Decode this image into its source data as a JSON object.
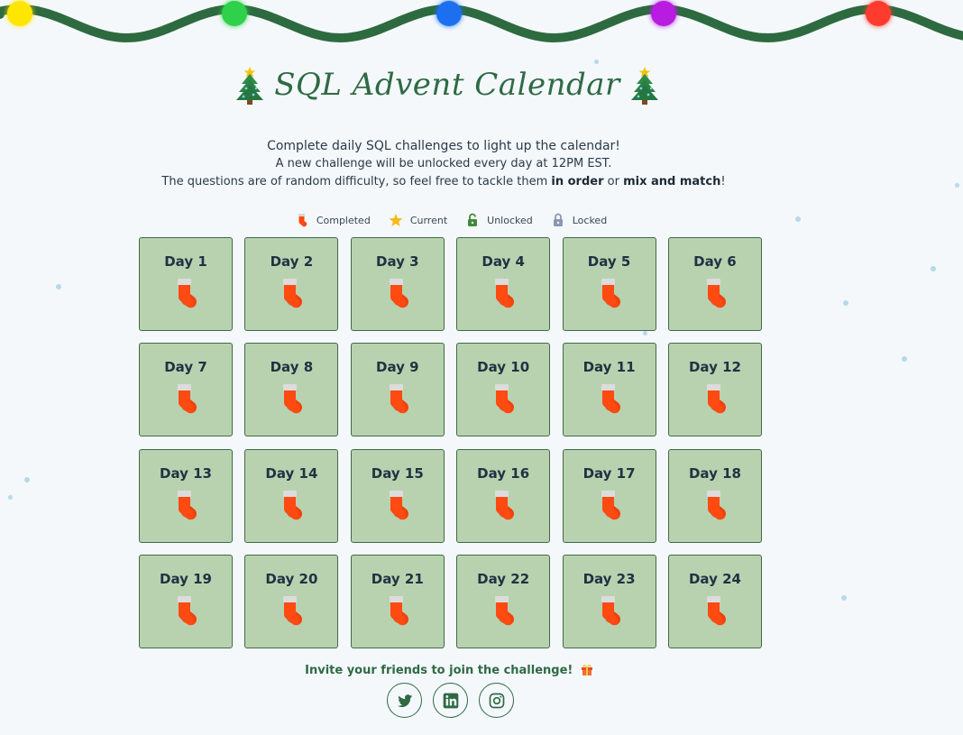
{
  "header": {
    "title": "SQL Advent Calendar",
    "left_icon": "christmas-tree-icon",
    "right_icon": "christmas-tree-icon"
  },
  "intro": {
    "line1": "Complete daily SQL challenges to light up the calendar!",
    "line2": "A new challenge will be unlocked every day at 12PM EST.",
    "line3_prefix": "The questions are of random difficulty, so feel free to tackle them ",
    "line3_bold1": "in order",
    "line3_mid": " or ",
    "line3_bold2": "mix and match",
    "line3_suffix": "!"
  },
  "legend": [
    {
      "label": "Completed",
      "icon": "stocking-icon"
    },
    {
      "label": "Current",
      "icon": "star-icon"
    },
    {
      "label": "Unlocked",
      "icon": "unlocked-padlock-icon"
    },
    {
      "label": "Locked",
      "icon": "locked-padlock-icon"
    }
  ],
  "days": [
    {
      "label": "Day 1",
      "status": "completed"
    },
    {
      "label": "Day 2",
      "status": "completed"
    },
    {
      "label": "Day 3",
      "status": "completed"
    },
    {
      "label": "Day 4",
      "status": "completed"
    },
    {
      "label": "Day 5",
      "status": "completed"
    },
    {
      "label": "Day 6",
      "status": "completed"
    },
    {
      "label": "Day 7",
      "status": "completed"
    },
    {
      "label": "Day 8",
      "status": "completed"
    },
    {
      "label": "Day 9",
      "status": "completed"
    },
    {
      "label": "Day 10",
      "status": "completed"
    },
    {
      "label": "Day 11",
      "status": "completed"
    },
    {
      "label": "Day 12",
      "status": "completed"
    },
    {
      "label": "Day 13",
      "status": "completed"
    },
    {
      "label": "Day 14",
      "status": "completed"
    },
    {
      "label": "Day 15",
      "status": "completed"
    },
    {
      "label": "Day 16",
      "status": "completed"
    },
    {
      "label": "Day 17",
      "status": "completed"
    },
    {
      "label": "Day 18",
      "status": "completed"
    },
    {
      "label": "Day 19",
      "status": "completed"
    },
    {
      "label": "Day 20",
      "status": "completed"
    },
    {
      "label": "Day 21",
      "status": "completed"
    },
    {
      "label": "Day 22",
      "status": "completed"
    },
    {
      "label": "Day 23",
      "status": "completed"
    },
    {
      "label": "Day 24",
      "status": "completed"
    }
  ],
  "footer": {
    "invite_text": "Invite your friends to join the challenge!",
    "invite_icon": "gift-icon",
    "socials": [
      {
        "name": "twitter",
        "icon": "twitter-icon"
      },
      {
        "name": "linkedin",
        "icon": "linkedin-icon"
      },
      {
        "name": "instagram",
        "icon": "instagram-icon"
      }
    ]
  },
  "colors": {
    "background": "#f4f8fb",
    "tile": "#b8d2b0",
    "tile_border": "#3f6b47",
    "brand_green": "#2f6a44",
    "garland": "#2e6a3f",
    "stocking": "#ff4a12",
    "bulbs": [
      "#ffe600",
      "#2fd14a",
      "#1a6ff0",
      "#b81fe0",
      "#ff3a2e"
    ]
  }
}
